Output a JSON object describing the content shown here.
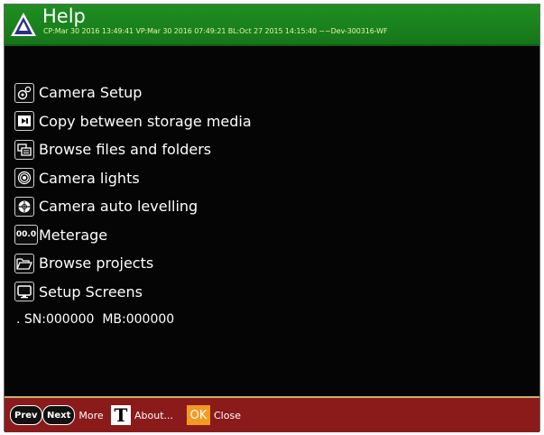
{
  "header": {
    "title": "Help",
    "build_info": "CP:Mar 30 2016 13:49:41  VP:Mar 30 2016 07:49:21  BL:Oct 27 2015 14:15:40  ~~Dev-300316-WF"
  },
  "menu": {
    "items": [
      {
        "label": "Camera Setup",
        "icon": "camera-setup-icon"
      },
      {
        "label": "Copy between storage media",
        "icon": "copy-media-icon"
      },
      {
        "label": "Browse files and folders",
        "icon": "browse-files-icon"
      },
      {
        "label": "Camera lights",
        "icon": "camera-lights-icon"
      },
      {
        "label": "Camera auto levelling",
        "icon": "auto-level-icon"
      },
      {
        "label": "Meterage",
        "icon": "meterage-icon",
        "icon_text": "00.0"
      },
      {
        "label": "Browse projects",
        "icon": "folder-open-icon"
      },
      {
        "label": "Setup Screens",
        "icon": "monitor-icon"
      }
    ]
  },
  "serial_line": ". SN:000000  MB:000000",
  "footer": {
    "prev_label": "Prev",
    "next_label": "Next",
    "more_label": "More",
    "about_key": "T",
    "about_label": "About...",
    "ok_key": "OK",
    "close_label": "Close"
  },
  "colors": {
    "titlebar": "#1b8a1f",
    "footer": "#8b1b1b",
    "ok_button": "#f39a22",
    "background": "#050505"
  }
}
